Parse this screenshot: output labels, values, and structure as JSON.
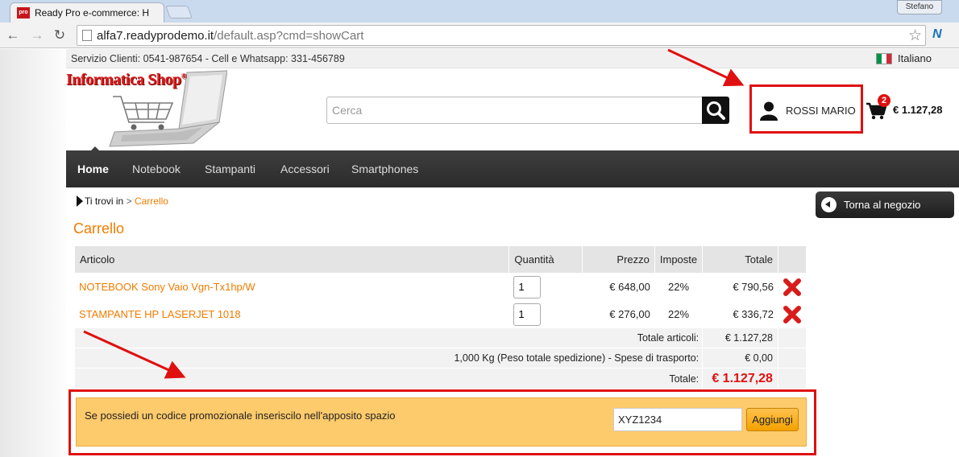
{
  "browser": {
    "tab_title": "Ready Pro e-commerce: H",
    "favicon_text": "pro",
    "profile_name": "Stefano",
    "url_host": "alfa7.readyprodemo.it",
    "url_path": "/default.asp?cmd=showCart"
  },
  "infobar": {
    "service_text": "Servizio Clienti: 0541-987654 - Cell e Whatsapp: 331-456789",
    "language": "Italiano"
  },
  "header": {
    "logo_text": "Informatica Shop",
    "logo_mark": "®",
    "search_placeholder": "Cerca",
    "user_name": "ROSSI MARIO",
    "cart_count": "2",
    "cart_total": "€ 1.127,28"
  },
  "nav": {
    "items": [
      "Home",
      "Notebook",
      "Stampanti",
      "Accessori",
      "Smartphones"
    ]
  },
  "breadcrumb": {
    "prefix": "Ti trovi in",
    "separator": ">",
    "current": "Carrello"
  },
  "back_button_label": "Torna al negozio",
  "page_title": "Carrello",
  "cart": {
    "headers": {
      "article": "Articolo",
      "qty": "Quantità",
      "price": "Prezzo",
      "tax": "Imposte",
      "total": "Totale"
    },
    "rows": [
      {
        "article": "NOTEBOOK Sony Vaio Vgn-Tx1hp/W",
        "qty": "1",
        "price": "€ 648,00",
        "tax": "22%",
        "total": "€ 790,56"
      },
      {
        "article": "STAMPANTE HP LASERJET 1018",
        "qty": "1",
        "price": "€ 276,00",
        "tax": "22%",
        "total": "€ 336,72"
      }
    ],
    "articles_total_label": "Totale articoli:",
    "articles_total": "€ 1.127,28",
    "weight_note": "1,000 Kg (Peso totale spedizione) -",
    "shipping_label": "Spese di trasporto:",
    "shipping_value": "€ 0,00",
    "grand_total_label": "Totale:",
    "grand_total": "€ 1.127,28"
  },
  "promo": {
    "text": "Se possiedi un codice promozionale inseriscilo nell'apposito spazio",
    "code_value": "XYZ1234",
    "button_label": "Aggiungi"
  },
  "colors": {
    "accent_orange": "#f07c00",
    "annotation_red": "#e01010",
    "promo_bg": "#fdca6c",
    "nav_bg": "#333333"
  }
}
